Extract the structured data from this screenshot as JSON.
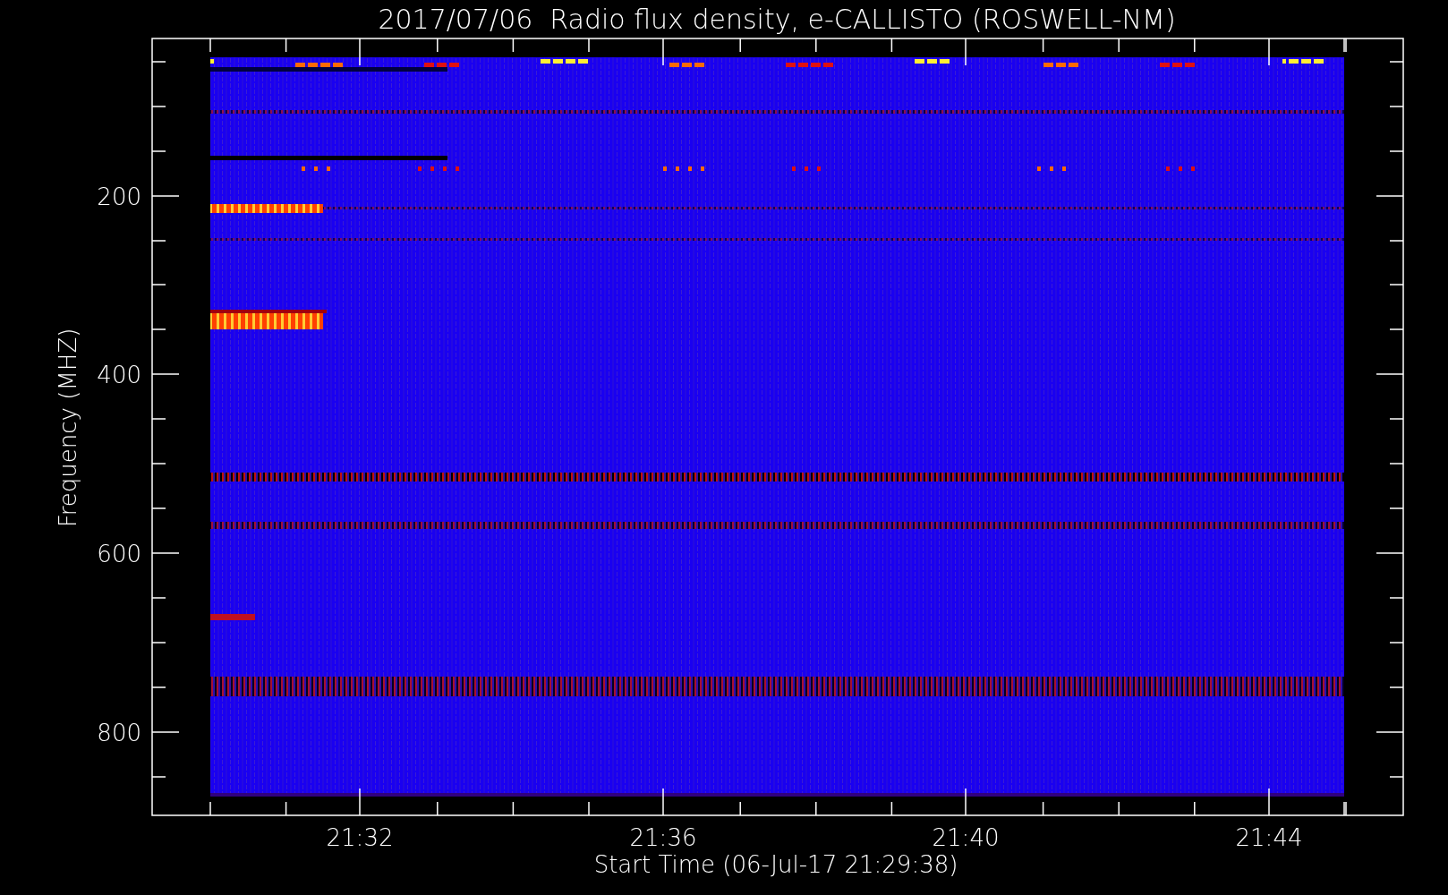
{
  "plot": {
    "title": "2017/07/06  Radio flux density, e-CALLISTO (ROSWELL-NM)",
    "ylabel": "Frequency (MHZ)",
    "xlabel": "Start Time (06-Jul-17 21:29:38)",
    "y_tick_labels": [
      "200",
      "400",
      "600",
      "800"
    ],
    "x_tick_labels": [
      "21:32",
      "21:36",
      "21:40",
      "21:44"
    ]
  }
}
